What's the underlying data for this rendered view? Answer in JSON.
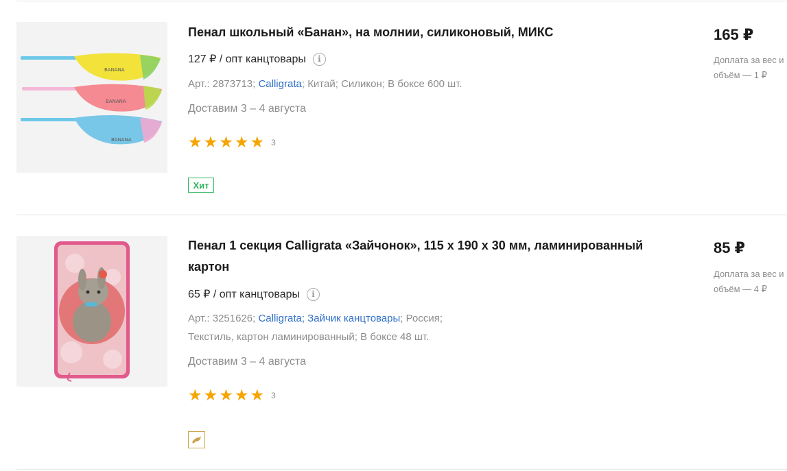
{
  "products": [
    {
      "title": "Пенал школьный «Банан», на молнии, силиконовый, МИКС",
      "wholesale_price": "127 ₽ / опт канцтовары",
      "article_label": "Арт.: 2873713;",
      "brand": "Calligrata",
      "country": "Китай;",
      "material": "Силикон;",
      "box": "В боксе 600 шт.",
      "delivery": "Доставим 3 – 4 августа",
      "rating_count": "3",
      "rating_value": 5,
      "badge": "Хит",
      "price": "165 ₽",
      "surcharge": "Доплата за вес и объём — 1 ₽"
    },
    {
      "title": "Пенал 1 секция Calligrata «Зайчонок», 115 х 190 х 30 мм, ламинированный картон",
      "wholesale_price": "65 ₽ / опт канцтовары",
      "article_label": "Арт.: 3251626;",
      "brand": "Calligrata;",
      "series": "Зайчик канцтовары",
      "country": "Россия;",
      "material": "Текстиль, картон ламинированный;",
      "box": "В боксе 48 шт.",
      "delivery": "Доставим 3 – 4 августа",
      "rating_count": "3",
      "rating_value": 5,
      "badge_icon": "dolphin-icon",
      "price": "85 ₽",
      "surcharge": "Доплата за вес и объём — 4 ₽"
    }
  ],
  "colors": {
    "link": "#2f6fc6",
    "star": "#f5a400",
    "badge_hit": "#2db65b"
  },
  "banana_label": "BANANA"
}
